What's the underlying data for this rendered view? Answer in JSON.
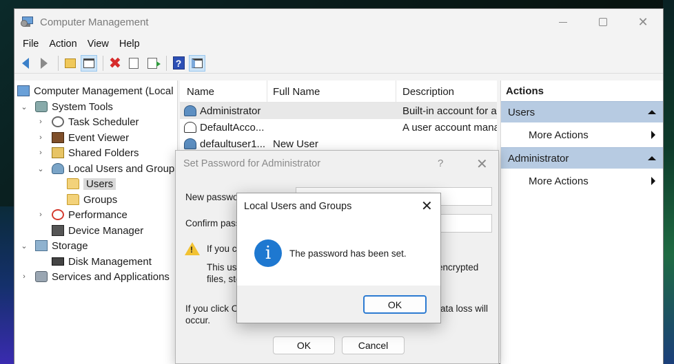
{
  "window": {
    "title": "Computer Management"
  },
  "menu": [
    "File",
    "Action",
    "View",
    "Help"
  ],
  "toolbar": {
    "icons": [
      "back-icon",
      "forward-icon",
      "up-folder-icon",
      "show-hide-console-tree-icon",
      "delete-icon",
      "properties-icon",
      "export-list-icon",
      "help-icon",
      "show-hide-action-pane-icon"
    ]
  },
  "tree": {
    "root": "Computer Management (Local",
    "system_tools": "System Tools",
    "task_scheduler": "Task Scheduler",
    "event_viewer": "Event Viewer",
    "shared_folders": "Shared Folders",
    "local_users": "Local Users and Groups",
    "users": "Users",
    "groups": "Groups",
    "performance": "Performance",
    "device_manager": "Device Manager",
    "storage": "Storage",
    "disk_management": "Disk Management",
    "services": "Services and Applications"
  },
  "list": {
    "columns": [
      "Name",
      "Full Name",
      "Description"
    ],
    "rows": [
      {
        "name": "Administrator",
        "full_name": "",
        "description": "Built-in account for a"
      },
      {
        "name": "DefaultAcco...",
        "full_name": "",
        "description": "A user account mana"
      },
      {
        "name": "defaultuser1...",
        "full_name": "New User",
        "description": ""
      }
    ]
  },
  "actions": {
    "header": "Actions",
    "section1": "Users",
    "section1_item": "More Actions",
    "section2": "Administrator",
    "section2_item": "More Actions"
  },
  "set_password_dialog": {
    "title": "Set Password for Administrator",
    "help_glyph": "?",
    "new_password_label": "New passwo",
    "confirm_password_label": "Confirm pass",
    "warning_line1": "If you c",
    "warning_line2": "This us",
    "warning_line3": "files, sto",
    "warning_line2_tail": "encrypted",
    "footer_line1": "If you click C",
    "footer_line2": "occur.",
    "footer_line1_tail": "ata loss will",
    "ok_label": "OK",
    "cancel_label": "Cancel"
  },
  "message_box": {
    "title": "Local Users and Groups",
    "message": "The password has been set.",
    "ok_label": "OK",
    "info_glyph": "i"
  }
}
